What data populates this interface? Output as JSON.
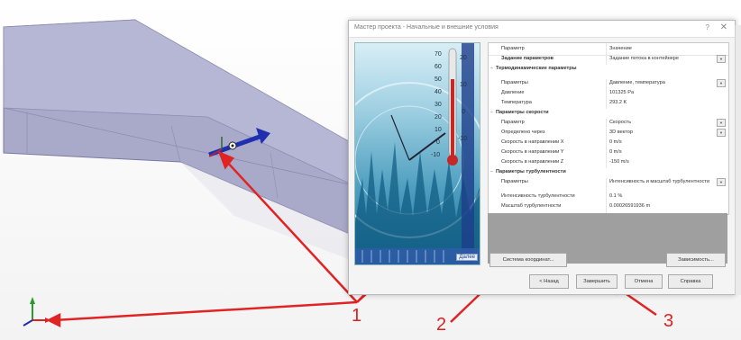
{
  "dialog": {
    "title": "Мастер проекта - Начальные и внешние условия",
    "help_glyph": "?",
    "close_glyph": "✕",
    "next_label": "Далее"
  },
  "tree": [
    {
      "type": "header",
      "label": "Параметр",
      "value": "Значение"
    },
    {
      "type": "row",
      "label": "Задание параметров",
      "value": "Задание потока в контейнере",
      "bold": true,
      "dropdown": true
    },
    {
      "type": "group",
      "label": "Термодинамические параметры",
      "toggle": "−"
    },
    {
      "type": "row",
      "label": "Параметры",
      "value": "Давление, температура",
      "dropdown": true
    },
    {
      "type": "row",
      "label": "Давление",
      "value": "101325 Pa"
    },
    {
      "type": "row",
      "label": "Температура",
      "value": "293.2 K"
    },
    {
      "type": "group",
      "label": "Параметры скорости",
      "toggle": "−"
    },
    {
      "type": "row",
      "label": "Параметр",
      "value": "Скорость",
      "dropdown": true
    },
    {
      "type": "row",
      "label": "Определено через",
      "value": "3D вектор",
      "dropdown": true
    },
    {
      "type": "row",
      "label": "Скорость в направлении X",
      "value": "0 m/s"
    },
    {
      "type": "row",
      "label": "Скорость в направлении Y",
      "value": "0 m/s"
    },
    {
      "type": "row",
      "label": "Скорость в направлении Z",
      "value": "-150 m/s"
    },
    {
      "type": "group",
      "label": "Параметры турбулентности",
      "toggle": "−"
    },
    {
      "type": "row",
      "label": "Параметры",
      "value": "Интенсивность и масштаб турбулентности",
      "dropdown": true,
      "tall": true
    },
    {
      "type": "row",
      "label": "Интенсивность турбулентности",
      "value": "0.1 %"
    },
    {
      "type": "row",
      "label": "Масштаб турбулентности",
      "value": "0.00026591936 m"
    }
  ],
  "buttons": {
    "coord": "Система координат...",
    "dependency": "Зависимость...",
    "back": "< Назад",
    "finish": "Завершить",
    "cancel": "Отмена",
    "help": "Справка"
  },
  "picture": {
    "thermometer_scale": [
      "70",
      "60",
      "50",
      "40",
      "30",
      "20",
      "10",
      "0",
      "-10"
    ],
    "thermometer_right": [
      "20",
      "10",
      "0",
      "-10",
      "-20"
    ]
  },
  "callouts": [
    "1",
    "2",
    "3"
  ],
  "colors": {
    "arrow": "#e02424",
    "wing_top": "#a9aac9",
    "wing_edge": "#7a7aa3",
    "vector_arrow": "#1f2fb0"
  }
}
